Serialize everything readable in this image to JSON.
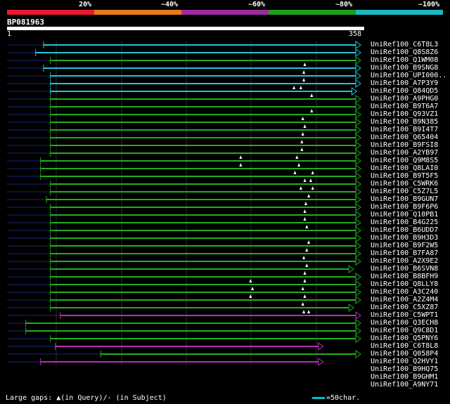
{
  "header": {
    "percent_labels": [
      "20%",
      "~40%",
      "~60%",
      "~80%",
      "~100%"
    ],
    "band_colors": [
      "#e8192c",
      "#e87a1e",
      "#a12aa1",
      "#1f9e1f",
      "#17b9c4"
    ]
  },
  "query": {
    "id": "BP081963",
    "start": "1",
    "end": "358"
  },
  "colors": {
    "green": "#1fae1f",
    "cyan": "#22c4d6",
    "magenta": "#b530b5",
    "gap": "#1a237e",
    "grid": "#2b2b2b"
  },
  "hits": [
    {
      "name": "UniRef100_C6T8L3",
      "color": "cyan",
      "start": 37,
      "end": 358,
      "gaps": []
    },
    {
      "name": "UniRef100_Q8S8Z6",
      "color": "cyan",
      "start": 29,
      "end": 358,
      "gaps": []
    },
    {
      "name": "UniRef100_Q1WM08",
      "color": "green",
      "start": 44,
      "end": 358,
      "gaps": []
    },
    {
      "name": "UniRef100_B9SNG8",
      "color": "cyan",
      "start": 37,
      "end": 358,
      "gaps": [
        302
      ]
    },
    {
      "name": "UniRef100_UPI000..",
      "color": "cyan",
      "start": 44,
      "end": 358,
      "gaps": [
        301
      ]
    },
    {
      "name": "UniRef100_A7P3Y9",
      "color": "cyan",
      "start": 44,
      "end": 358,
      "gaps": [
        301
      ]
    },
    {
      "name": "UniRef100_Q84QD5",
      "color": "cyan",
      "start": 44,
      "end": 354,
      "gaps": [
        291,
        298
      ]
    },
    {
      "name": "UniRef100_A9PHG0",
      "color": "green",
      "start": 44,
      "end": 358,
      "gaps": [
        309
      ]
    },
    {
      "name": "UniRef100_B9T6A7",
      "color": "green",
      "start": 44,
      "end": 358,
      "gaps": []
    },
    {
      "name": "UniRef100_Q93VZ1",
      "color": "green",
      "start": 44,
      "end": 358,
      "gaps": [
        309
      ]
    },
    {
      "name": "UniRef100_B9N385",
      "color": "green",
      "start": 44,
      "end": 358,
      "gaps": [
        300
      ]
    },
    {
      "name": "UniRef100_B9I4T7",
      "color": "green",
      "start": 44,
      "end": 358,
      "gaps": [
        302
      ]
    },
    {
      "name": "UniRef100_Q65404",
      "color": "green",
      "start": 44,
      "end": 358,
      "gaps": [
        300
      ]
    },
    {
      "name": "UniRef100_B9FSI8",
      "color": "green",
      "start": 44,
      "end": 358,
      "gaps": [
        299
      ]
    },
    {
      "name": "UniRef100_A2YB97",
      "color": "green",
      "start": 44,
      "end": 358,
      "gaps": [
        299
      ]
    },
    {
      "name": "UniRef100_Q9M8S5",
      "color": "green",
      "start": 34,
      "end": 358,
      "gaps": [
        237,
        294
      ]
    },
    {
      "name": "UniRef100_Q8LAI0",
      "color": "green",
      "start": 34,
      "end": 358,
      "gaps": [
        237,
        296
      ]
    },
    {
      "name": "UniRef100_B9T5F5",
      "color": "green",
      "start": 34,
      "end": 358,
      "gaps": [
        292,
        310
      ]
    },
    {
      "name": "UniRef100_C5WRK6",
      "color": "green",
      "start": 44,
      "end": 358,
      "gaps": [
        302,
        308
      ]
    },
    {
      "name": "UniRef100_C5Z7L5",
      "color": "green",
      "start": 44,
      "end": 358,
      "gaps": [
        298,
        310
      ]
    },
    {
      "name": "UniRef100_B9GUN7",
      "color": "green",
      "start": 40,
      "end": 358,
      "gaps": [
        306
      ]
    },
    {
      "name": "UniRef100_B9F6P6",
      "color": "green",
      "start": 44,
      "end": 358,
      "gaps": [
        303
      ]
    },
    {
      "name": "UniRef100_Q10PB1",
      "color": "green",
      "start": 44,
      "end": 358,
      "gaps": [
        302
      ]
    },
    {
      "name": "UniRef100_B4G225",
      "color": "green",
      "start": 44,
      "end": 358,
      "gaps": [
        302
      ]
    },
    {
      "name": "UniRef100_B6UDD7",
      "color": "green",
      "start": 44,
      "end": 358,
      "gaps": [
        304
      ]
    },
    {
      "name": "UniRef100_B9H3D3",
      "color": "green",
      "start": 44,
      "end": 358,
      "gaps": []
    },
    {
      "name": "UniRef100_B9F2W5",
      "color": "green",
      "start": 44,
      "end": 358,
      "gaps": [
        306
      ]
    },
    {
      "name": "UniRef100_B7FA87",
      "color": "green",
      "start": 44,
      "end": 358,
      "gaps": [
        304
      ]
    },
    {
      "name": "UniRef100_A2X9E2",
      "color": "green",
      "start": 44,
      "end": 358,
      "gaps": [
        301
      ]
    },
    {
      "name": "UniRef100_B6SVN8",
      "color": "green",
      "start": 44,
      "end": 351,
      "gaps": [
        304
      ]
    },
    {
      "name": "UniRef100_B8BFH9",
      "color": "green",
      "start": 44,
      "end": 358,
      "gaps": [
        302
      ]
    },
    {
      "name": "UniRef100_Q8LLY8",
      "color": "green",
      "start": 44,
      "end": 358,
      "gaps": [
        247,
        302
      ]
    },
    {
      "name": "UniRef100_A3C240",
      "color": "green",
      "start": 44,
      "end": 358,
      "gaps": [
        249,
        300
      ]
    },
    {
      "name": "UniRef100_A2Z4M4",
      "color": "green",
      "start": 44,
      "end": 358,
      "gaps": [
        247,
        302
      ]
    },
    {
      "name": "UniRef100_C5XZ87",
      "color": "green",
      "start": 44,
      "end": 351,
      "gaps": [
        300
      ]
    },
    {
      "name": "UniRef100_C5WPT1",
      "color": "magenta",
      "start": 54,
      "end": 358,
      "gaps": [
        301,
        306
      ]
    },
    {
      "name": "UniRef100_Q3ECH8",
      "color": "green",
      "start": 19,
      "end": 358,
      "gaps": []
    },
    {
      "name": "UniRef100_Q9C8D1",
      "color": "green",
      "start": 19,
      "end": 358,
      "gaps": []
    },
    {
      "name": "UniRef100_Q5PNY6",
      "color": "green",
      "start": 44,
      "end": 358,
      "gaps": []
    },
    {
      "name": "UniRef100_C6T8L8",
      "color": "magenta",
      "start": 49,
      "end": 320,
      "gaps": []
    },
    {
      "name": "UniRef100_Q058P4",
      "color": "green",
      "start": 95,
      "end": 358,
      "gaps": []
    },
    {
      "name": "UniRef100_Q2HVY1",
      "color": "magenta",
      "start": 34,
      "end": 320,
      "gaps": []
    },
    {
      "name": "UniRef100_B9HQ75",
      "color": "magenta",
      "start": 34,
      "end": 320,
      "gaps": []
    },
    {
      "name": "UniRef100_B9GHM1",
      "color": "magenta",
      "start": 34,
      "end": 320,
      "gaps": []
    },
    {
      "name": "UniRef100_A9NY71",
      "color": "magenta",
      "start": 54,
      "end": 358,
      "gaps": [
        310
      ]
    }
  ],
  "footer": {
    "legend_text": "Large gaps: ▲(in Query)/- (in Subject)",
    "scale_text": "=50char."
  }
}
